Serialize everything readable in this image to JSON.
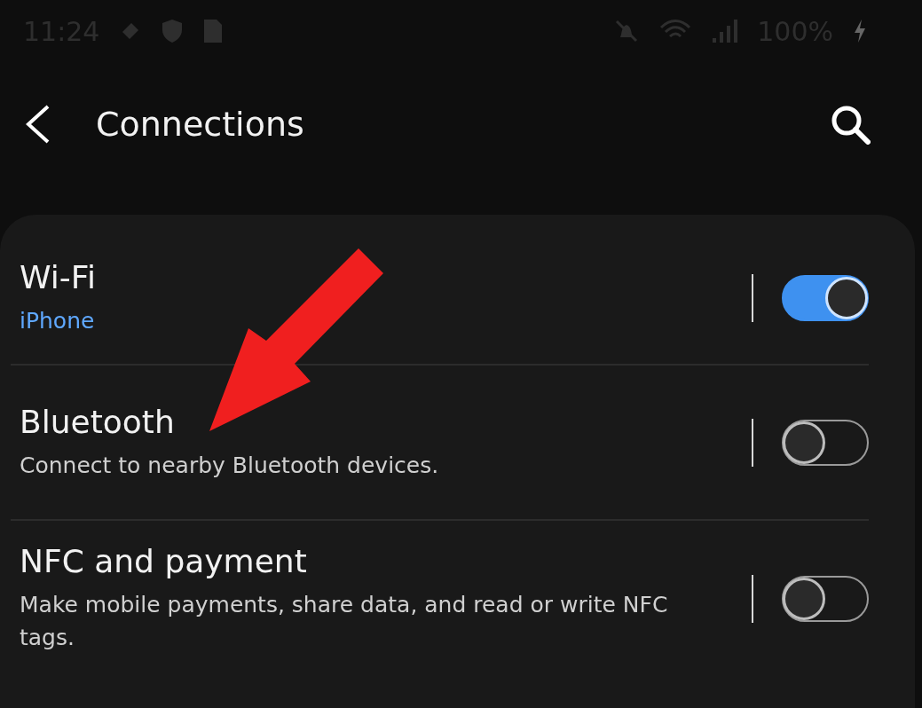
{
  "status_bar": {
    "time": "11:24",
    "battery": "100%"
  },
  "header": {
    "title": "Connections"
  },
  "settings": [
    {
      "title": "Wi-Fi",
      "subtitle": "iPhone",
      "subtitle_highlighted": true,
      "on": true
    },
    {
      "title": "Bluetooth",
      "subtitle": "Connect to nearby Bluetooth devices.",
      "subtitle_highlighted": false,
      "on": false
    },
    {
      "title": "NFC and payment",
      "subtitle": "Make mobile payments, share data, and read or write NFC tags.",
      "subtitle_highlighted": false,
      "on": false
    }
  ]
}
